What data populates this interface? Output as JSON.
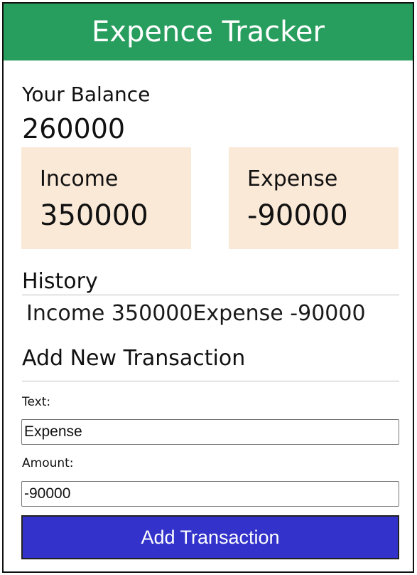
{
  "header": {
    "title": "Expence Tracker"
  },
  "balance": {
    "label": "Your Balance",
    "value": "260000"
  },
  "summary": {
    "income": {
      "label": "Income",
      "value": "350000"
    },
    "expense": {
      "label": "Expense",
      "value": "-90000"
    }
  },
  "history": {
    "title": "History",
    "entries_text": "Income 350000Expense -90000"
  },
  "form": {
    "title": "Add New Transaction",
    "text_label": "Text:",
    "text_value": "Expense",
    "amount_label": "Amount:",
    "amount_value": "-90000",
    "submit_label": "Add Transaction"
  },
  "colors": {
    "header_bg": "#289e5e",
    "summary_box_bg": "#fae9d7",
    "button_bg": "#3333cc"
  }
}
